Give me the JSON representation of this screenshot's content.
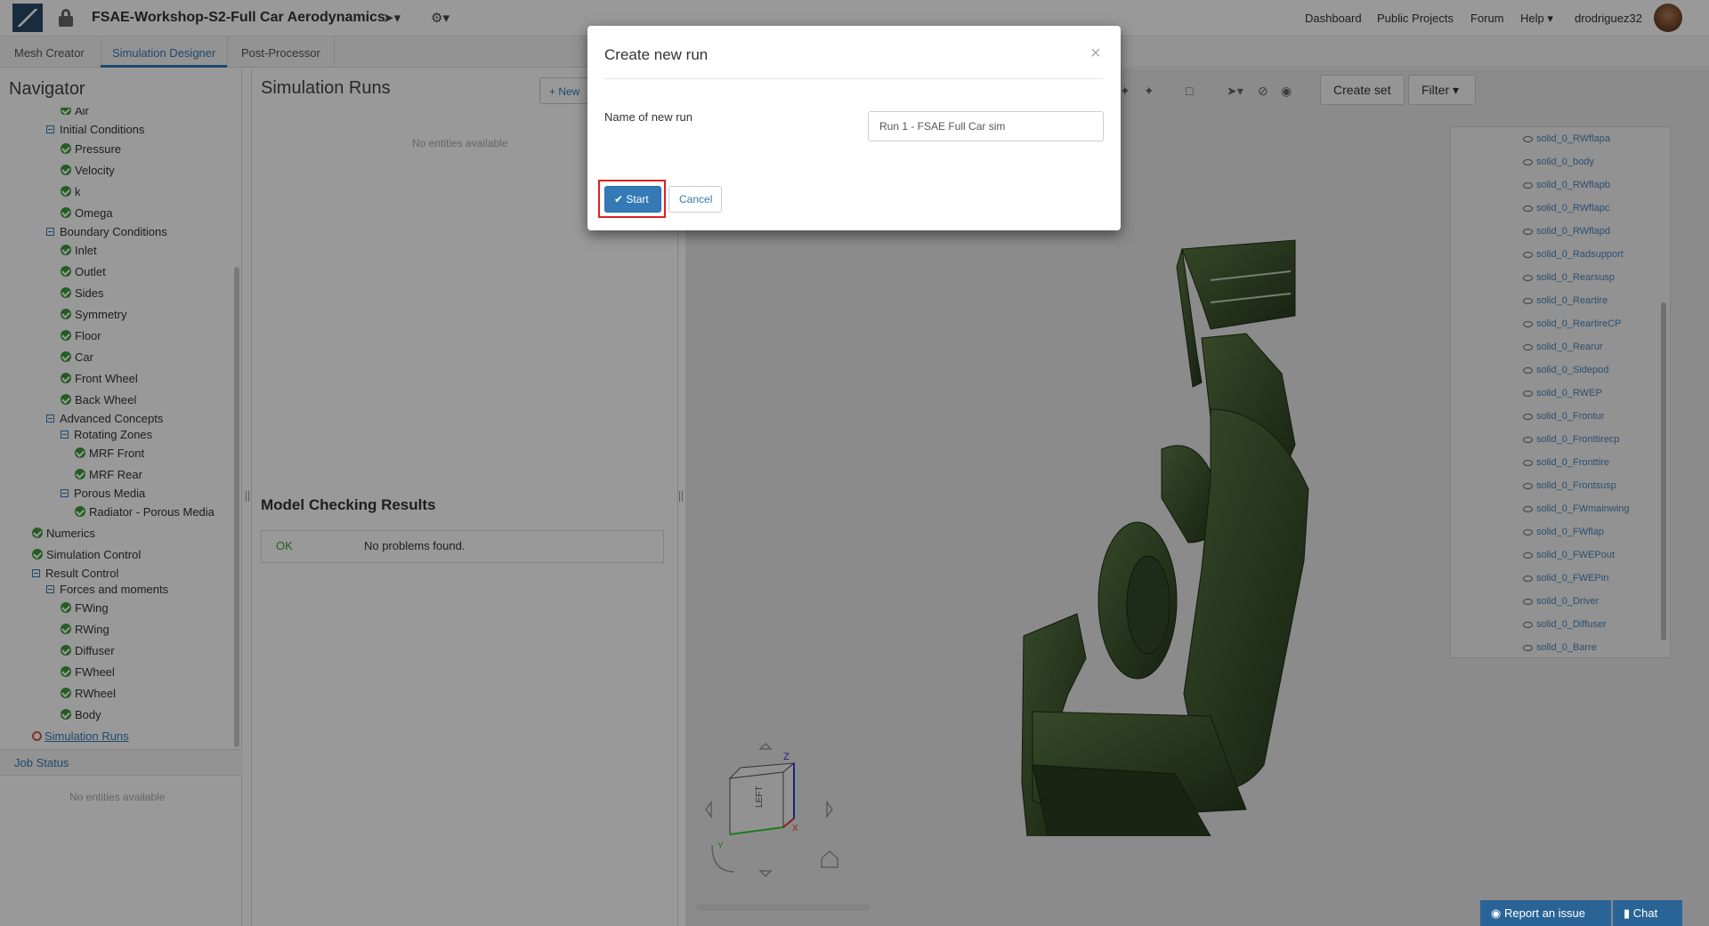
{
  "topbar": {
    "project_title": "FSAE-Workshop-S2-Full Car Aerodynamics",
    "nav": [
      "Dashboard",
      "Public Projects",
      "Forum",
      "Help",
      "drodriguez32"
    ]
  },
  "tabs": [
    "Mesh Creator",
    "Simulation Designer",
    "Post-Processor"
  ],
  "navigator": {
    "title": "Navigator",
    "tree": [
      {
        "label": "Air",
        "kind": "check",
        "indent": 2
      },
      {
        "label": "Initial Conditions",
        "kind": "minus",
        "indent": 1
      },
      {
        "label": "Pressure",
        "kind": "check",
        "indent": 2
      },
      {
        "label": "Velocity",
        "kind": "check",
        "indent": 2
      },
      {
        "label": "k",
        "kind": "check",
        "indent": 2
      },
      {
        "label": "Omega",
        "kind": "check",
        "indent": 2
      },
      {
        "label": "Boundary Conditions",
        "kind": "minus",
        "indent": 1
      },
      {
        "label": "Inlet",
        "kind": "check",
        "indent": 2
      },
      {
        "label": "Outlet",
        "kind": "check",
        "indent": 2
      },
      {
        "label": "Sides",
        "kind": "check",
        "indent": 2
      },
      {
        "label": "Symmetry",
        "kind": "check",
        "indent": 2
      },
      {
        "label": "Floor",
        "kind": "check",
        "indent": 2
      },
      {
        "label": "Car",
        "kind": "check",
        "indent": 2
      },
      {
        "label": "Front Wheel",
        "kind": "check",
        "indent": 2
      },
      {
        "label": "Back Wheel",
        "kind": "check",
        "indent": 2
      },
      {
        "label": "Advanced Concepts",
        "kind": "minus",
        "indent": 1
      },
      {
        "label": "Rotating Zones",
        "kind": "minus",
        "indent": 2
      },
      {
        "label": "MRF Front",
        "kind": "check",
        "indent": 3
      },
      {
        "label": "MRF Rear",
        "kind": "check",
        "indent": 3
      },
      {
        "label": "Porous Media",
        "kind": "minus",
        "indent": 2
      },
      {
        "label": "Radiator - Porous Media",
        "kind": "check",
        "indent": 3
      },
      {
        "label": "Numerics",
        "kind": "check",
        "indent": 0
      },
      {
        "label": "Simulation Control",
        "kind": "check",
        "indent": 0
      },
      {
        "label": "Result Control",
        "kind": "minus",
        "indent": 0
      },
      {
        "label": "Forces and moments",
        "kind": "minus",
        "indent": 1
      },
      {
        "label": "FWing",
        "kind": "check",
        "indent": 2
      },
      {
        "label": "RWing",
        "kind": "check",
        "indent": 2
      },
      {
        "label": "Diffuser",
        "kind": "check",
        "indent": 2
      },
      {
        "label": "FWheel",
        "kind": "check",
        "indent": 2
      },
      {
        "label": "RWheel",
        "kind": "check",
        "indent": 2
      },
      {
        "label": "Body",
        "kind": "check",
        "indent": 2
      },
      {
        "label": "Simulation Runs",
        "kind": "ring",
        "indent": 0
      }
    ],
    "job_status": "Job Status",
    "job_status_empty": "No entities available"
  },
  "simulation_runs": {
    "title": "Simulation Runs",
    "new_label": "New",
    "empty": "No entities available"
  },
  "model_checking": {
    "title": "Model Checking Results",
    "status": "OK",
    "message": "No problems found."
  },
  "viewer": {
    "create_set": "Create set",
    "filter": "Filter",
    "parts": [
      "solid_0_RWflapa",
      "solid_0_body",
      "solid_0_RWflapb",
      "solid_0_RWflapc",
      "solid_0_RWflapd",
      "solid_0_Radsupport",
      "solid_0_Rearsusp",
      "solid_0_Reartire",
      "solid_0_ReartireCP",
      "solid_0_Rearur",
      "solid_0_Sidepod",
      "solid_0_RWEP",
      "solid_0_Frontur",
      "solid_0_Fronttirecp",
      "solid_0_Fronttire",
      "solid_0_Frontsusp",
      "solid_0_FWmainwing",
      "solid_0_FWflap",
      "solid_0_FWEPout",
      "solid_0_FWEPin",
      "solid_0_Driver",
      "solid_0_Diffuser",
      "solid_0_Barre"
    ],
    "cube_face": "LEFT"
  },
  "footer": {
    "report": "Report an issue",
    "chat": "Chat"
  },
  "modal": {
    "title": "Create new run",
    "name_label": "Name of new run",
    "name_value": "Run 1 - FSAE Full Car sim",
    "start_label": "Start",
    "cancel_label": "Cancel"
  },
  "colors": {
    "accent": "#337ab7",
    "ok_green": "#3c9a3c",
    "car_green": "#3f5a2e",
    "highlight_red": "#e02020"
  }
}
